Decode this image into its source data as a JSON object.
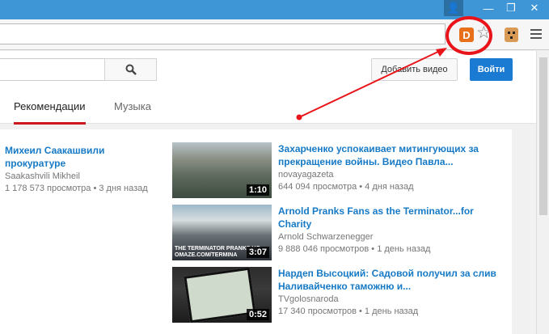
{
  "window": {
    "min_glyph": "—",
    "max_glyph": "❐",
    "close_glyph": "✕",
    "user_glyph": "👤"
  },
  "toolbar": {
    "ext_d_label": "D",
    "star_glyph": "☆"
  },
  "masthead": {
    "search_placeholder": "",
    "upload_label": "Добавить видео",
    "signin_label": "Войти"
  },
  "tabs": [
    {
      "label": "Рекомендации",
      "active": true
    },
    {
      "label": "Музыка",
      "active": false
    }
  ],
  "left_item": {
    "title": "Михеил Саакашвили прокуратуре",
    "channel": "Saakashvili Mikheil",
    "meta": "1 178 573 просмотра • 3 дня назад"
  },
  "videos": [
    {
      "title": "Захарченко успокаивает митингующих за прекращение войны. Видео Павла...",
      "channel": "novayagazeta",
      "meta": "644 094 просмотра • 4 дня назад",
      "duration": "1:10"
    },
    {
      "title": "Arnold Pranks Fans as the Terminator...for Charity",
      "channel": "Arnold Schwarzenegger",
      "meta": "9 888 046 просмотров • 1 день назад",
      "duration": "3:07",
      "overlay": "THE TERMINATOR PRANKS HO\nOMAZE.COM/TERMINA"
    },
    {
      "title": "Нардеп Высоцкий: Садовой получил за слив Наливайченко таможню и...",
      "channel": "TVgolosnaroda",
      "meta": "17 340 просмотров • 1 день назад",
      "duration": "0:52"
    }
  ],
  "colors": {
    "accent": "#cc181e",
    "link": "#167ac6",
    "signin": "#1b7ad1",
    "annotation": "#e8141a",
    "titlebar": "#3f96d6"
  }
}
